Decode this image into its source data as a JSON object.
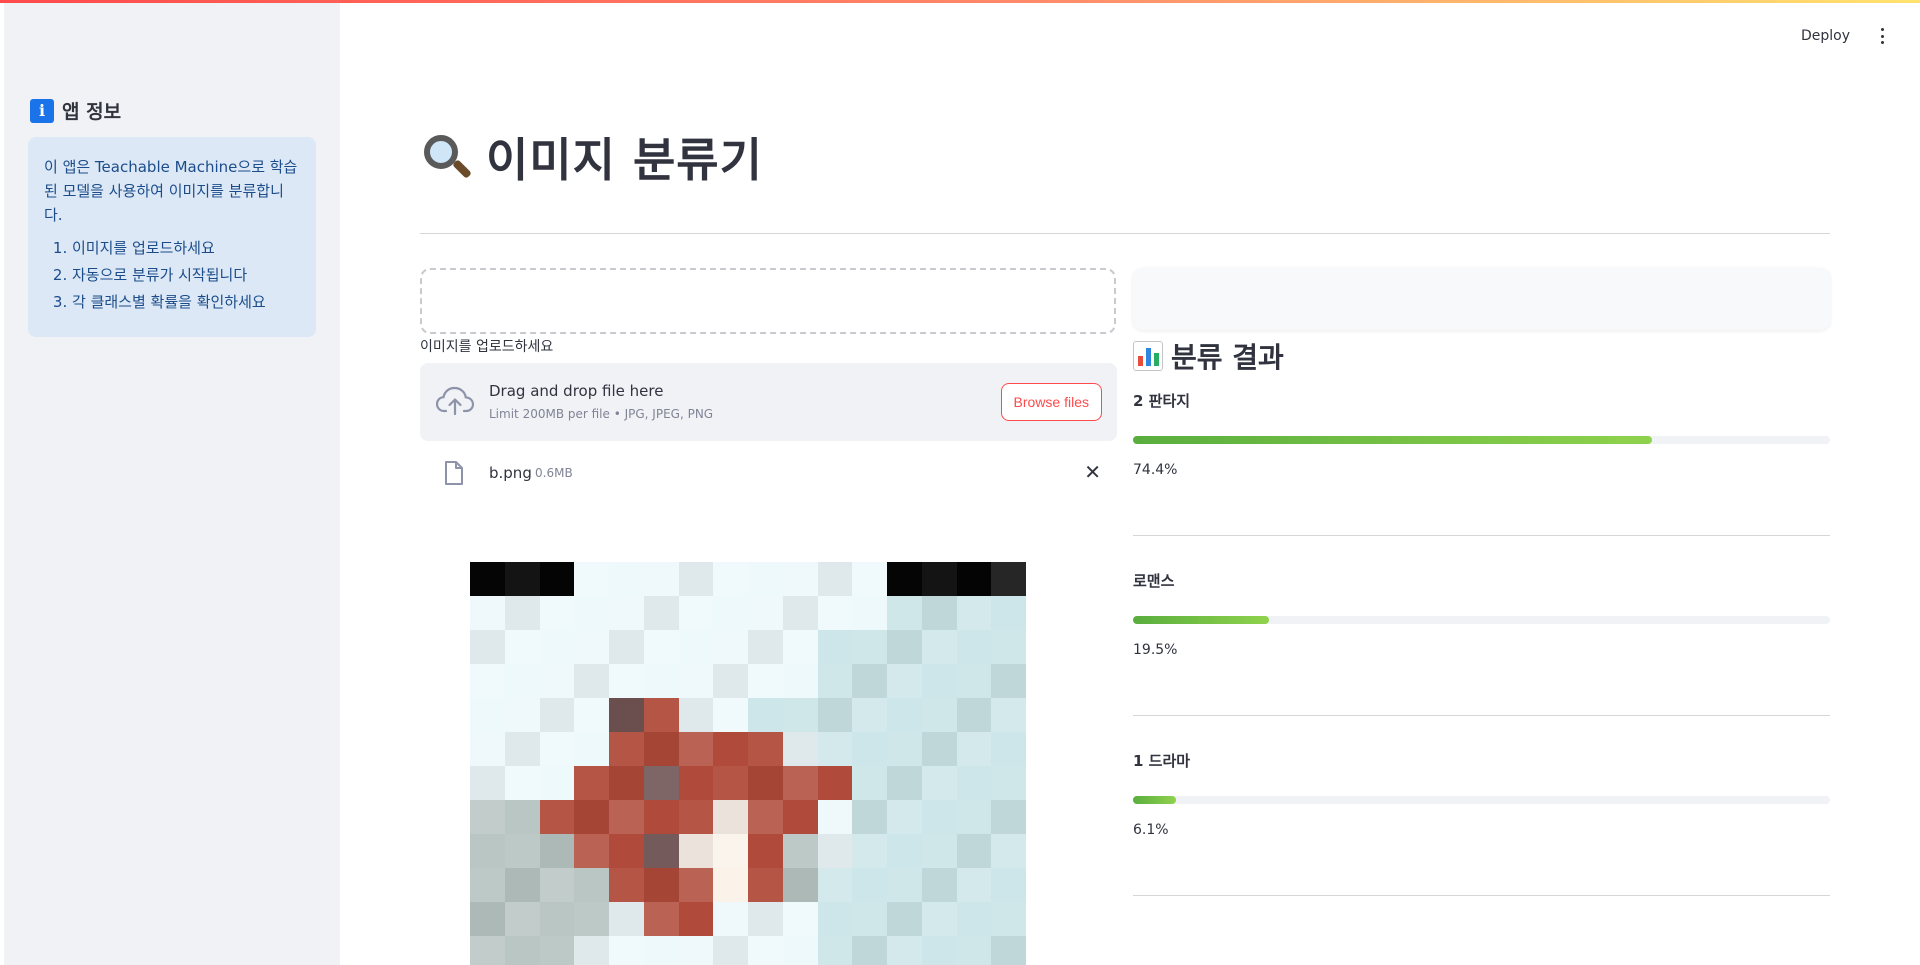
{
  "sidebar": {
    "title": "앱 정보",
    "icon": "info-icon",
    "description": "이 앱은 Teachable Machine으로 학습된 모델을 사용하여 이미지를 분류합니다.",
    "steps": [
      "이미지를 업로드하세요",
      "자동으로 분류가 시작됩니다",
      "각 클래스별 확률을 확인하세요"
    ]
  },
  "header": {
    "deploy_label": "Deploy"
  },
  "main": {
    "title": "이미지 분류기",
    "title_icon": "magnifier-icon",
    "uploader": {
      "label": "이미지를 업로드하세요",
      "drop_text": "Drag and drop file here",
      "limit_text": "Limit 200MB per file • JPG, JPEG, PNG",
      "browse_label": "Browse files"
    },
    "file": {
      "name": "b.png",
      "size": "0.6MB"
    }
  },
  "results": {
    "title": "분류 결과",
    "title_icon": "bar-chart-icon",
    "bar_color": "#7cc44a",
    "items": [
      {
        "label": "2 판타지",
        "value": 74.4,
        "percent_text": "74.4%"
      },
      {
        "label": "로맨스",
        "value": 19.5,
        "percent_text": "19.5%"
      },
      {
        "label": "1 드라마",
        "value": 6.1,
        "percent_text": "6.1%"
      }
    ]
  }
}
